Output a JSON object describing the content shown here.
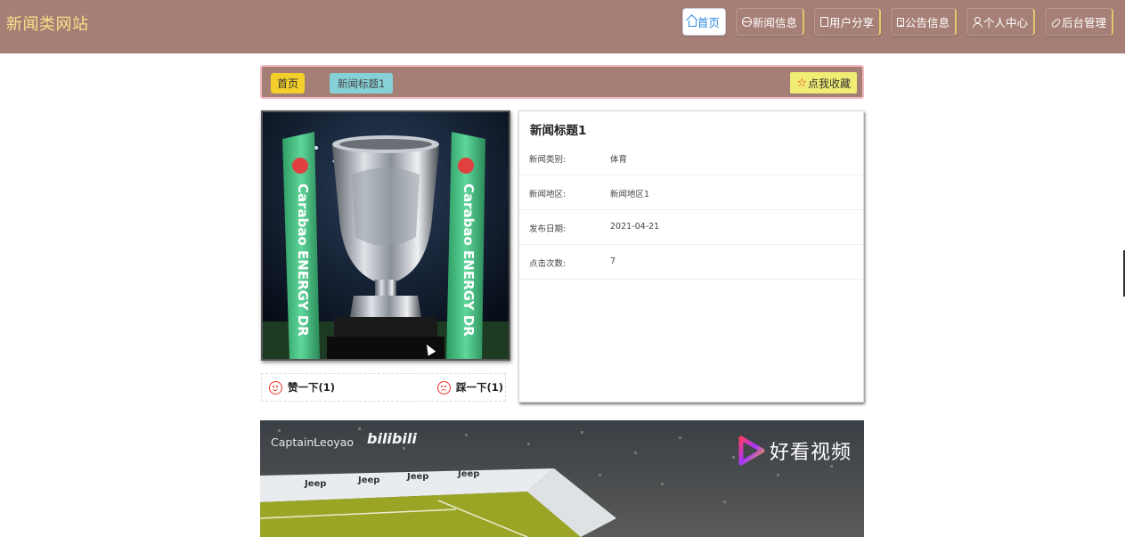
{
  "header": {
    "site_title": "新闻类网站",
    "nav": [
      {
        "label": "首页",
        "icon": "home-icon",
        "active": true
      },
      {
        "label": "新闻信息",
        "icon": "globe-icon"
      },
      {
        "label": "用户分享",
        "icon": "document-icon"
      },
      {
        "label": "公告信息",
        "icon": "list-icon"
      },
      {
        "label": "个人中心",
        "icon": "user-icon"
      },
      {
        "label": "后台管理",
        "icon": "link-icon"
      }
    ]
  },
  "breadcrumb": {
    "home": "首页",
    "current": "新闻标题1",
    "favorite_label": "点我收藏",
    "favorite_icon": "star-icon"
  },
  "news": {
    "title": "新闻标题1",
    "fields": [
      {
        "label": "新闻类别:",
        "value": "体育"
      },
      {
        "label": "新闻地区:",
        "value": "新闻地区1"
      },
      {
        "label": "发布日期:",
        "value": "2021-04-21"
      },
      {
        "label": "点击次数:",
        "value": "7"
      }
    ],
    "image_ribbon_text": "Carabao ENERGY DR"
  },
  "votes": {
    "like_label": "赞一下(1)",
    "dislike_label": "踩一下(1)"
  },
  "video": {
    "watermark": "CaptainLeoyao",
    "bili": "bilibili",
    "logo_text": "好看视频",
    "ad_text": "Jeep"
  },
  "colors": {
    "header_bg": "#a57f75",
    "title_color": "#f7e08a",
    "active_nav_text": "#2d8ae0",
    "home_crumb": "#f4cf2c",
    "current_crumb": "#86d1d8",
    "favorite_btn": "#f0ec74",
    "vote_icon": "#e8311f"
  }
}
